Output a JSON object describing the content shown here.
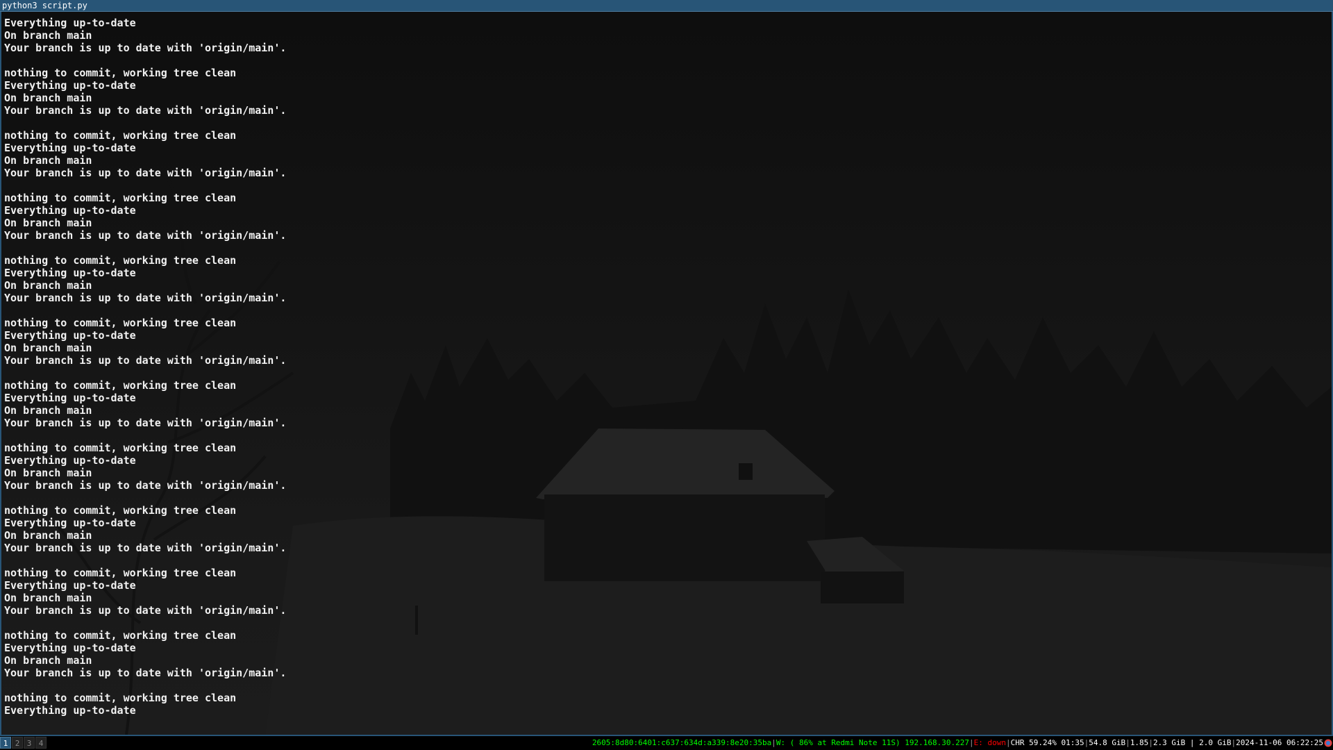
{
  "window": {
    "title": "python3 script.py"
  },
  "terminal": {
    "lines": [
      "Everything up-to-date",
      "On branch main",
      "Your branch is up to date with 'origin/main'.",
      "",
      "nothing to commit, working tree clean",
      "Everything up-to-date",
      "On branch main",
      "Your branch is up to date with 'origin/main'.",
      "",
      "nothing to commit, working tree clean",
      "Everything up-to-date",
      "On branch main",
      "Your branch is up to date with 'origin/main'.",
      "",
      "nothing to commit, working tree clean",
      "Everything up-to-date",
      "On branch main",
      "Your branch is up to date with 'origin/main'.",
      "",
      "nothing to commit, working tree clean",
      "Everything up-to-date",
      "On branch main",
      "Your branch is up to date with 'origin/main'.",
      "",
      "nothing to commit, working tree clean",
      "Everything up-to-date",
      "On branch main",
      "Your branch is up to date with 'origin/main'.",
      "",
      "nothing to commit, working tree clean",
      "Everything up-to-date",
      "On branch main",
      "Your branch is up to date with 'origin/main'.",
      "",
      "nothing to commit, working tree clean",
      "Everything up-to-date",
      "On branch main",
      "Your branch is up to date with 'origin/main'.",
      "",
      "nothing to commit, working tree clean",
      "Everything up-to-date",
      "On branch main",
      "Your branch is up to date with 'origin/main'.",
      "",
      "nothing to commit, working tree clean",
      "Everything up-to-date",
      "On branch main",
      "Your branch is up to date with 'origin/main'.",
      "",
      "nothing to commit, working tree clean",
      "Everything up-to-date",
      "On branch main",
      "Your branch is up to date with 'origin/main'.",
      "",
      "nothing to commit, working tree clean",
      "Everything up-to-date"
    ]
  },
  "workspaces": [
    {
      "label": "1",
      "active": true
    },
    {
      "label": "2",
      "active": false
    },
    {
      "label": "3",
      "active": false
    },
    {
      "label": "4",
      "active": false
    }
  ],
  "status": {
    "ipv6": "2605:8d80:6401:c637:634d:a339:8e20:35ba",
    "wireless": "W: ( 86% at Redmi Note 11S) 192.168.30.227",
    "ethernet": "E: down",
    "battery": "CHR 59.24% 01:35",
    "disk": "54.8 GiB",
    "load": "1.85",
    "memory": "2.3 GiB | 2.0 GiB",
    "datetime": "2024-11-06 06:22:25"
  },
  "colors": {
    "titlebar_bg": "#285577",
    "terminal_text": "#f2f2f2",
    "status_good": "#00ff00",
    "status_bad": "#ff0000"
  },
  "icons": {
    "tray": "tray-app-icon"
  }
}
